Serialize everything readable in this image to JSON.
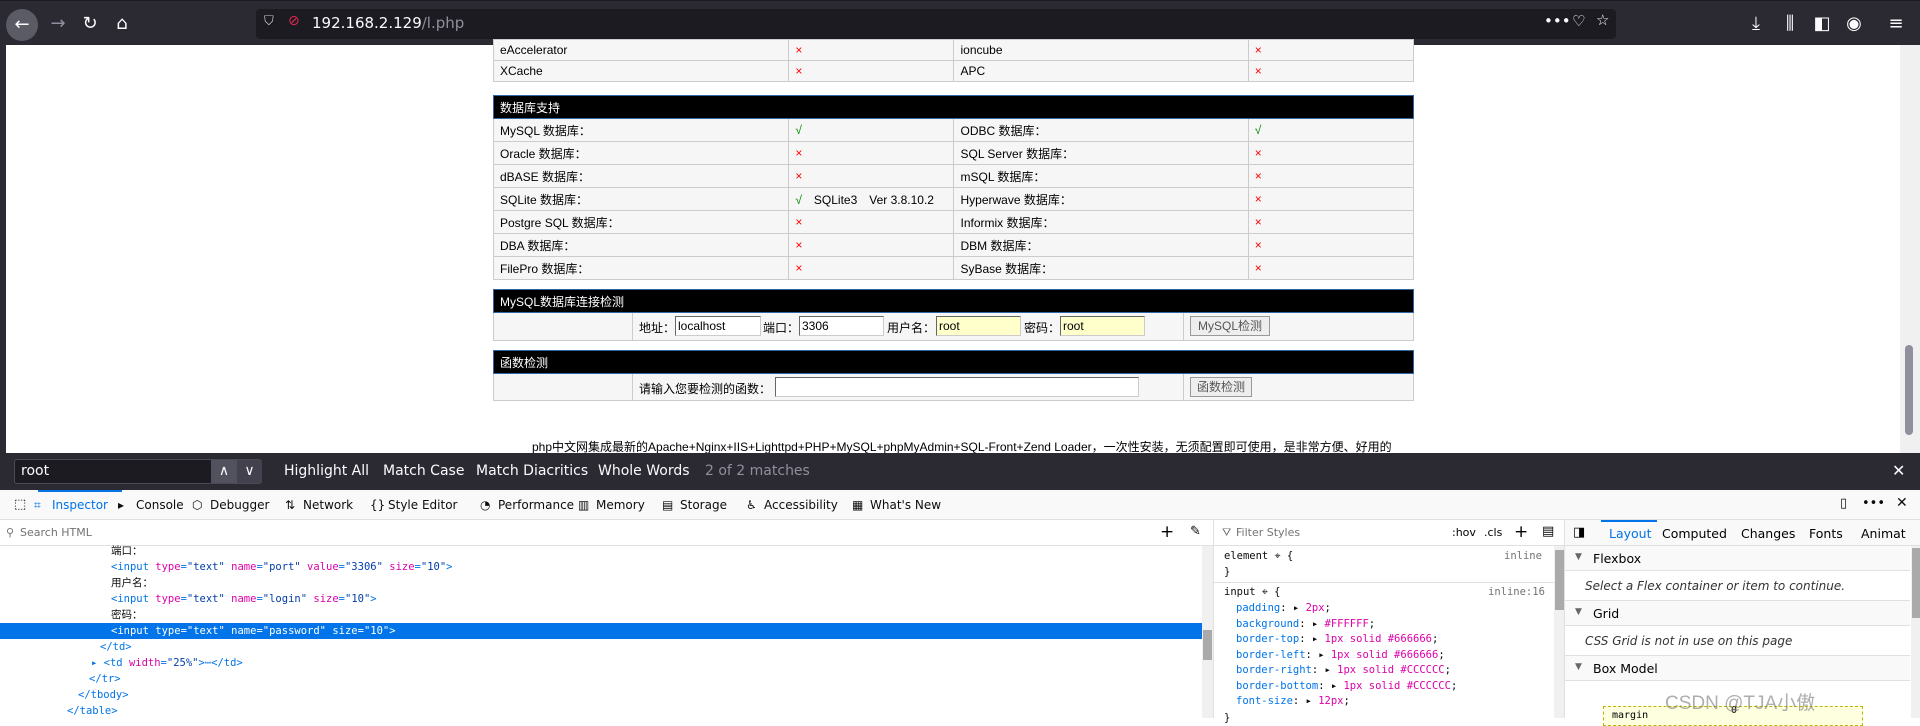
{
  "browser": {
    "url_host": "192.168.2.129",
    "url_path": "/l.php",
    "icons": [
      "back-icon",
      "forward-icon",
      "reload-icon",
      "home-icon",
      "shield-icon",
      "insecure-lock-icon",
      "more-icon",
      "pocket-icon",
      "bookmark-star-icon",
      "downloads-icon",
      "library-icon",
      "sidebar-icon",
      "account-icon",
      "menu-icon"
    ]
  },
  "accel_rows": [
    [
      "eAccelerator",
      "×",
      "ioncube",
      "×"
    ],
    [
      "XCache",
      "×",
      "APC",
      "×"
    ]
  ],
  "db": {
    "title": "数据库支持",
    "rows": [
      [
        "MySQL 数据库：",
        "√",
        "",
        "ODBC 数据库：",
        "√"
      ],
      [
        "Oracle 数据库：",
        "×",
        "",
        "SQL Server 数据库：",
        "×"
      ],
      [
        "dBASE 数据库：",
        "×",
        "",
        "mSQL 数据库：",
        "×"
      ],
      [
        "SQLite 数据库：",
        "√",
        "SQLite3　Ver 3.8.10.2",
        "Hyperwave 数据库：",
        "×"
      ],
      [
        "Postgre SQL 数据库：",
        "×",
        "",
        "Informix 数据库：",
        "×"
      ],
      [
        "DBA 数据库：",
        "×",
        "",
        "DBM 数据库：",
        "×"
      ],
      [
        "FilePro 数据库：",
        "×",
        "",
        "SyBase 数据库：",
        "×"
      ]
    ]
  },
  "mysql": {
    "title": "MySQL数据库连接检测",
    "addr_label": "地址：",
    "addr": "localhost",
    "port_label": "端口：",
    "port": "3306",
    "user_label": "用户名：",
    "user": "root",
    "pass_label": "密码：",
    "pass": "root",
    "button": "MySQL检测"
  },
  "func": {
    "title": "函数检测",
    "label": "请输入您要检测的函数：",
    "value": "",
    "button": "函数检测"
  },
  "footer": "php中文网集成最新的Apache+Nginx+IIS+Lighttpd+PHP+MySQL+phpMyAdmin+SQL-Front+Zend Loader，一次性安装，无须配置即可使用，是非常方便、好用的",
  "findbar": {
    "query": "root",
    "highlight_all": "Highlight All",
    "match_case": "Match Case",
    "match_diacritics": "Match Diacritics",
    "whole_words": "Whole Words",
    "status": "2 of 2 matches"
  },
  "devtools": {
    "tabs": [
      "Inspector",
      "Console",
      "Debugger",
      "Network",
      "Style Editor",
      "Performance",
      "Memory",
      "Storage",
      "Accessibility",
      "What's New"
    ],
    "search_placeholder": "Search HTML",
    "filter_placeholder": "Filter Styles",
    "hov": ":hov",
    "cls": ".cls",
    "markup": [
      {
        "t": "端口："
      },
      {
        "h": "<input type=\"text\" name=\"port\" value=\"3306\" size=\"10\">"
      },
      {
        "t": "用户名："
      },
      {
        "h": "<input type=\"text\" name=\"login\" size=\"10\">"
      },
      {
        "t": "密码："
      },
      {
        "h": "<input type=\"text\" name=\"password\" size=\"10\">",
        "selected": true
      },
      {
        "h": "</td>"
      },
      {
        "h": "▸ <td width=\"25%\">⋯</td>"
      },
      {
        "h": "</tr>"
      },
      {
        "h": "</tbody>"
      },
      {
        "h": "</table>"
      }
    ],
    "rules": {
      "element_sel": "element",
      "element_src": "inline",
      "input_sel": "input",
      "input_src": "inline:16",
      "props": [
        [
          "padding",
          "2px"
        ],
        [
          "background",
          "#FFFFFF"
        ],
        [
          "border-top",
          "1px solid #666666"
        ],
        [
          "border-left",
          "1px solid #666666"
        ],
        [
          "border-right",
          "1px solid #CCCCCC"
        ],
        [
          "border-bottom",
          "1px solid #CCCCCC"
        ],
        [
          "font-size",
          "12px"
        ]
      ]
    },
    "layout_tabs": [
      "Layout",
      "Computed",
      "Changes",
      "Fonts",
      "Animat"
    ],
    "flexbox": "Flexbox",
    "flex_msg": "Select a Flex container or item to continue.",
    "grid": "Grid",
    "grid_msg": "CSS Grid is not in use on this page",
    "box_model": "Box Model",
    "margin_label": "margin",
    "margin_value": "0"
  },
  "watermark": "CSDN @TJA小傲",
  "colors": {
    "header_bg": "#000000",
    "cross": "#ff0000",
    "check": "#008800",
    "selected_row": "#0074e8"
  }
}
